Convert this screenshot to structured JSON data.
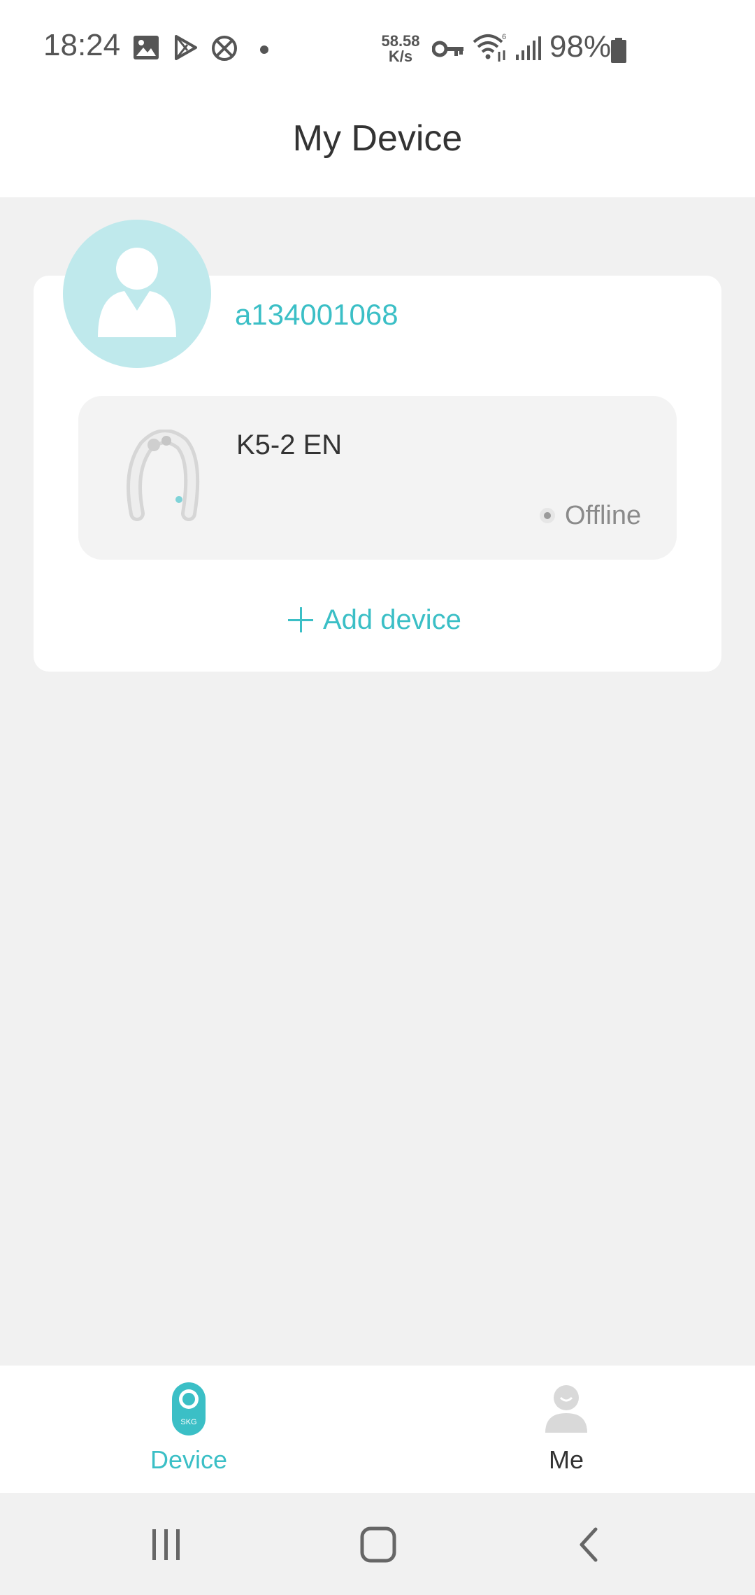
{
  "status_bar": {
    "time": "18:24",
    "net_speed_value": "58.58",
    "net_speed_unit": "K/s",
    "battery": "98%",
    "icons": [
      "image-icon",
      "play-store-icon",
      "do-not-disturb-icon",
      "notification-dot-icon",
      "vpn-key-icon",
      "wifi-icon",
      "signal-icon",
      "battery-icon"
    ]
  },
  "header": {
    "title": "My Device"
  },
  "user": {
    "username": "a134001068"
  },
  "devices": [
    {
      "name": "K5-2 EN",
      "status": "Offline",
      "image": "neck-massager-icon"
    }
  ],
  "add_device": {
    "label": "Add device"
  },
  "tabs": [
    {
      "label": "Device",
      "icon": "skg-device-icon",
      "active": true
    },
    {
      "label": "Me",
      "icon": "profile-icon",
      "active": false
    }
  ],
  "nav": {
    "buttons": [
      "recent-apps-icon",
      "home-icon",
      "back-icon"
    ]
  },
  "colors": {
    "accent": "#3bbfc6",
    "avatar_bg": "#bfe9ec",
    "background": "#f1f1f1"
  }
}
